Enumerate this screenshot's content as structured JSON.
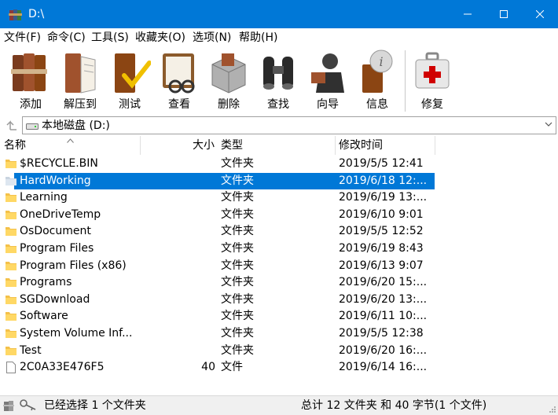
{
  "window": {
    "title": "D:\\",
    "minimize_icon": "minimize-icon",
    "maximize_icon": "maximize-icon",
    "close_icon": "close-icon"
  },
  "menu": [
    "文件(F)",
    "命令(C)",
    "工具(S)",
    "收藏夹(O)",
    "选项(N)",
    "帮助(H)"
  ],
  "toolbar": [
    {
      "label": "添加",
      "icon": "books-add-icon"
    },
    {
      "label": "解压到",
      "icon": "book-extract-icon"
    },
    {
      "label": "测试",
      "icon": "book-check-icon"
    },
    {
      "label": "查看",
      "icon": "book-glasses-icon"
    },
    {
      "label": "删除",
      "icon": "box-delete-icon"
    },
    {
      "label": "查找",
      "icon": "binoculars-icon"
    },
    {
      "label": "向导",
      "icon": "wizard-icon"
    },
    {
      "label": "信息",
      "icon": "info-icon"
    },
    {
      "label": "修复",
      "icon": "first-aid-icon"
    }
  ],
  "address": {
    "path": "本地磁盘 (D:)",
    "up_icon": "up-folder-icon",
    "drive_icon": "drive-icon"
  },
  "columns": {
    "name": "名称",
    "size": "大小",
    "type": "类型",
    "modified": "修改时间"
  },
  "files": [
    {
      "name": "$RECYCLE.BIN",
      "size": "",
      "type": "文件夹",
      "modified": "2019/5/5 12:41",
      "kind": "folder"
    },
    {
      "name": "HardWorking",
      "size": "",
      "type": "文件夹",
      "modified": "2019/6/18 12:...",
      "kind": "folder",
      "selected": true
    },
    {
      "name": "Learning",
      "size": "",
      "type": "文件夹",
      "modified": "2019/6/19 13:...",
      "kind": "folder"
    },
    {
      "name": "OneDriveTemp",
      "size": "",
      "type": "文件夹",
      "modified": "2019/6/10 9:01",
      "kind": "folder"
    },
    {
      "name": "OsDocument",
      "size": "",
      "type": "文件夹",
      "modified": "2019/5/5 12:52",
      "kind": "folder"
    },
    {
      "name": "Program Files",
      "size": "",
      "type": "文件夹",
      "modified": "2019/6/19 8:43",
      "kind": "folder"
    },
    {
      "name": "Program Files (x86)",
      "size": "",
      "type": "文件夹",
      "modified": "2019/6/13 9:07",
      "kind": "folder"
    },
    {
      "name": "Programs",
      "size": "",
      "type": "文件夹",
      "modified": "2019/6/20 15:...",
      "kind": "folder"
    },
    {
      "name": "SGDownload",
      "size": "",
      "type": "文件夹",
      "modified": "2019/6/20 13:...",
      "kind": "folder"
    },
    {
      "name": "Software",
      "size": "",
      "type": "文件夹",
      "modified": "2019/6/11 10:...",
      "kind": "folder"
    },
    {
      "name": "System Volume Inf...",
      "size": "",
      "type": "文件夹",
      "modified": "2019/5/5 12:38",
      "kind": "folder"
    },
    {
      "name": "Test",
      "size": "",
      "type": "文件夹",
      "modified": "2019/6/20 16:...",
      "kind": "folder"
    },
    {
      "name": "2C0A33E476F5",
      "size": "40",
      "type": "文件",
      "modified": "2019/6/14 16:...",
      "kind": "file"
    }
  ],
  "status": {
    "left": "已经选择 1 个文件夹",
    "right": "总计 12 文件夹 和 40 字节(1 个文件)"
  },
  "colors": {
    "titlebar": "#0078d7",
    "selection": "#0078d7",
    "folder": "#f4c14a"
  }
}
